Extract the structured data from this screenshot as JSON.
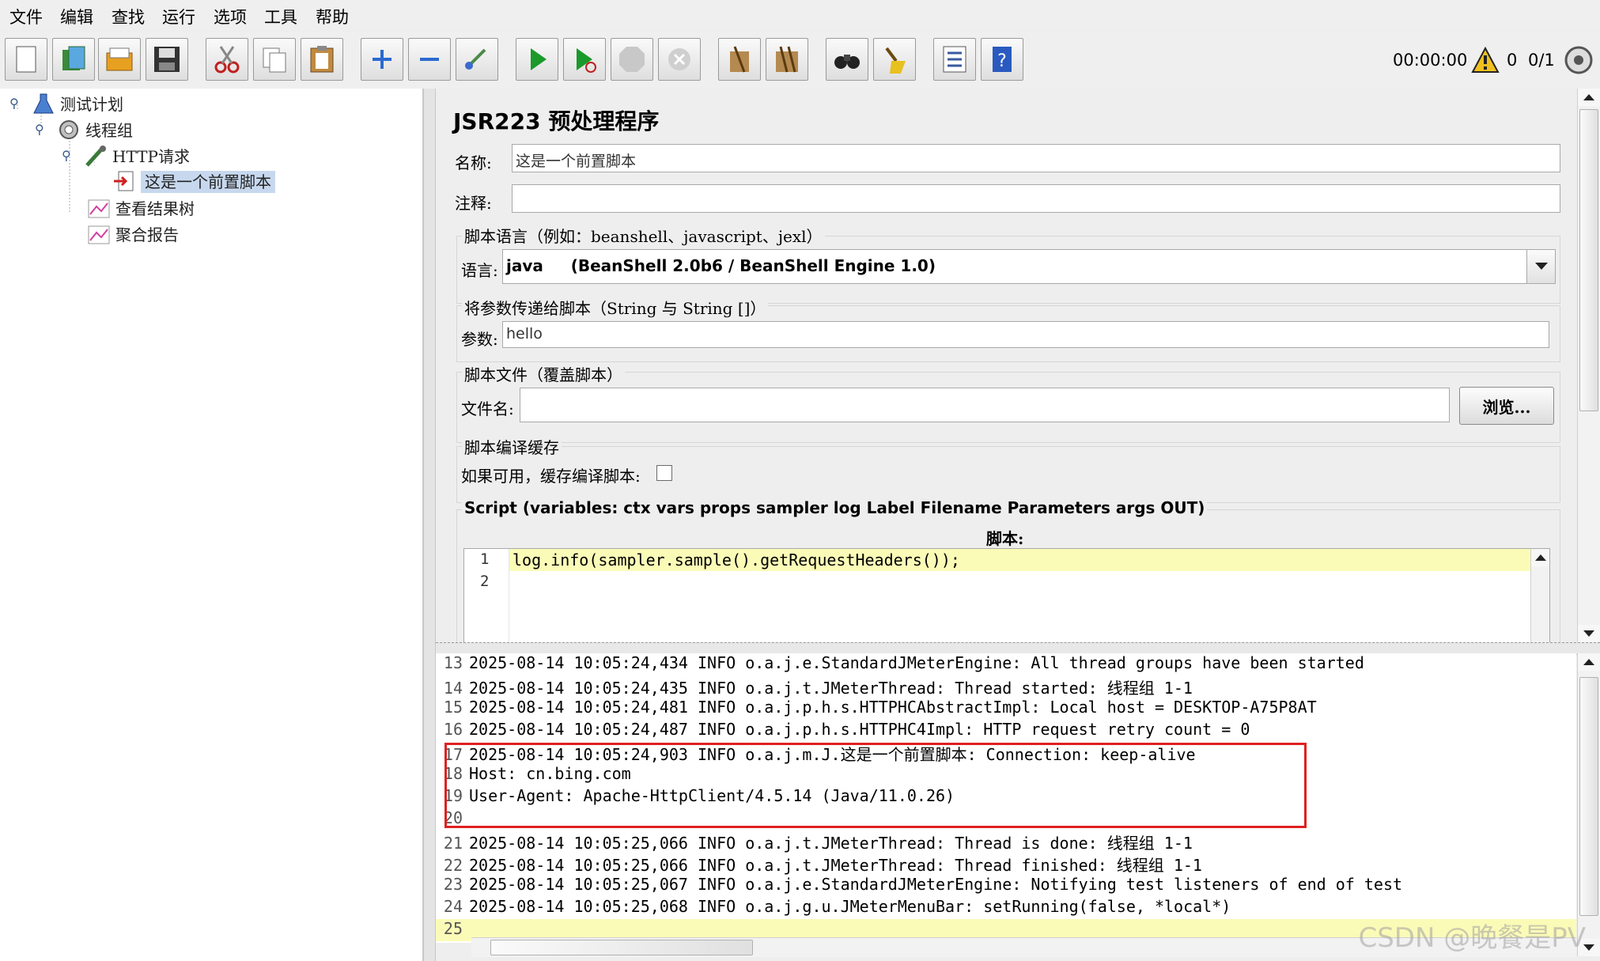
{
  "menu": [
    "文件",
    "编辑",
    "查找",
    "运行",
    "选项",
    "工具",
    "帮助"
  ],
  "toolbar": {
    "buttons": [
      "new-icon",
      "templates-icon",
      "open-icon",
      "save-icon",
      "cut-icon",
      "copy-icon",
      "paste-icon",
      "expand-icon",
      "collapse-icon",
      "toggle-icon",
      "start-icon",
      "start-no-pause-icon",
      "stop-icon",
      "shutdown-icon",
      "clear-icon",
      "clear-all-icon",
      "search-icon",
      "reset-search-icon",
      "function-helper-icon",
      "help-icon"
    ],
    "timer": "00:00:00",
    "warning_count": "0",
    "threads": "0/1"
  },
  "tree": {
    "items": [
      {
        "label": "测试计划"
      },
      {
        "label": "线程组"
      },
      {
        "label": "HTTP请求"
      },
      {
        "label": "这是一个前置脚本"
      },
      {
        "label": "查看结果树"
      },
      {
        "label": "聚合报告"
      }
    ]
  },
  "panel": {
    "title": "JSR223 预处理程序",
    "name_label": "名称:",
    "name_value": "这是一个前置脚本",
    "comment_label": "注释:",
    "comment_value": "",
    "lang_group": "脚本语言（例如：beanshell、javascript、jexl）",
    "lang_label": "语言:",
    "lang_value": "java     (BeanShell 2.0b6 / BeanShell Engine 1.0)",
    "params_group": "将参数传递给脚本（String 与 String []）",
    "params_label": "参数:",
    "params_value": "hello",
    "file_group": "脚本文件（覆盖脚本）",
    "file_label": "文件名:",
    "file_value": "",
    "browse_label": "浏览...",
    "cache_group": "脚本编译缓存",
    "cache_label": "如果可用，缓存编译脚本:",
    "cache_checked": false,
    "script_group": "Script (variables: ctx vars props sampler log Label Filename Parameters args OUT)",
    "script_label": "脚本:",
    "code_lines": [
      "log.info(sampler.sample().getRequestHeaders());",
      ""
    ],
    "line_numbers": [
      "1",
      "2"
    ]
  },
  "log": {
    "lines": [
      {
        "n": "13",
        "text": "2025-08-14 10:05:24,434 INFO o.a.j.e.StandardJMeterEngine: All thread groups have been started"
      },
      {
        "n": "14",
        "text": "2025-08-14 10:05:24,435 INFO o.a.j.t.JMeterThread: Thread started: 线程组 1-1"
      },
      {
        "n": "15",
        "text": "2025-08-14 10:05:24,481 INFO o.a.j.p.h.s.HTTPHCAbstractImpl: Local host = DESKTOP-A75P8AT"
      },
      {
        "n": "16",
        "text": "2025-08-14 10:05:24,487 INFO o.a.j.p.h.s.HTTPHC4Impl: HTTP request retry count = 0"
      },
      {
        "n": "17",
        "text": "2025-08-14 10:05:24,903 INFO o.a.j.m.J.这是一个前置脚本: Connection: keep-alive"
      },
      {
        "n": "18",
        "text": "Host: cn.bing.com"
      },
      {
        "n": "19",
        "text": "User-Agent: Apache-HttpClient/4.5.14 (Java/11.0.26)"
      },
      {
        "n": "20",
        "text": ""
      },
      {
        "n": "21",
        "text": "2025-08-14 10:05:25,066 INFO o.a.j.t.JMeterThread: Thread is done: 线程组 1-1"
      },
      {
        "n": "22",
        "text": "2025-08-14 10:05:25,066 INFO o.a.j.t.JMeterThread: Thread finished: 线程组 1-1"
      },
      {
        "n": "23",
        "text": "2025-08-14 10:05:25,067 INFO o.a.j.e.StandardJMeterEngine: Notifying test listeners of end of test"
      },
      {
        "n": "24",
        "text": "2025-08-14 10:05:25,068 INFO o.a.j.g.u.JMeterMenuBar: setRunning(false, *local*)"
      },
      {
        "n": "25",
        "text": ""
      }
    ]
  },
  "watermark": "CSDN @晚餐是PV"
}
